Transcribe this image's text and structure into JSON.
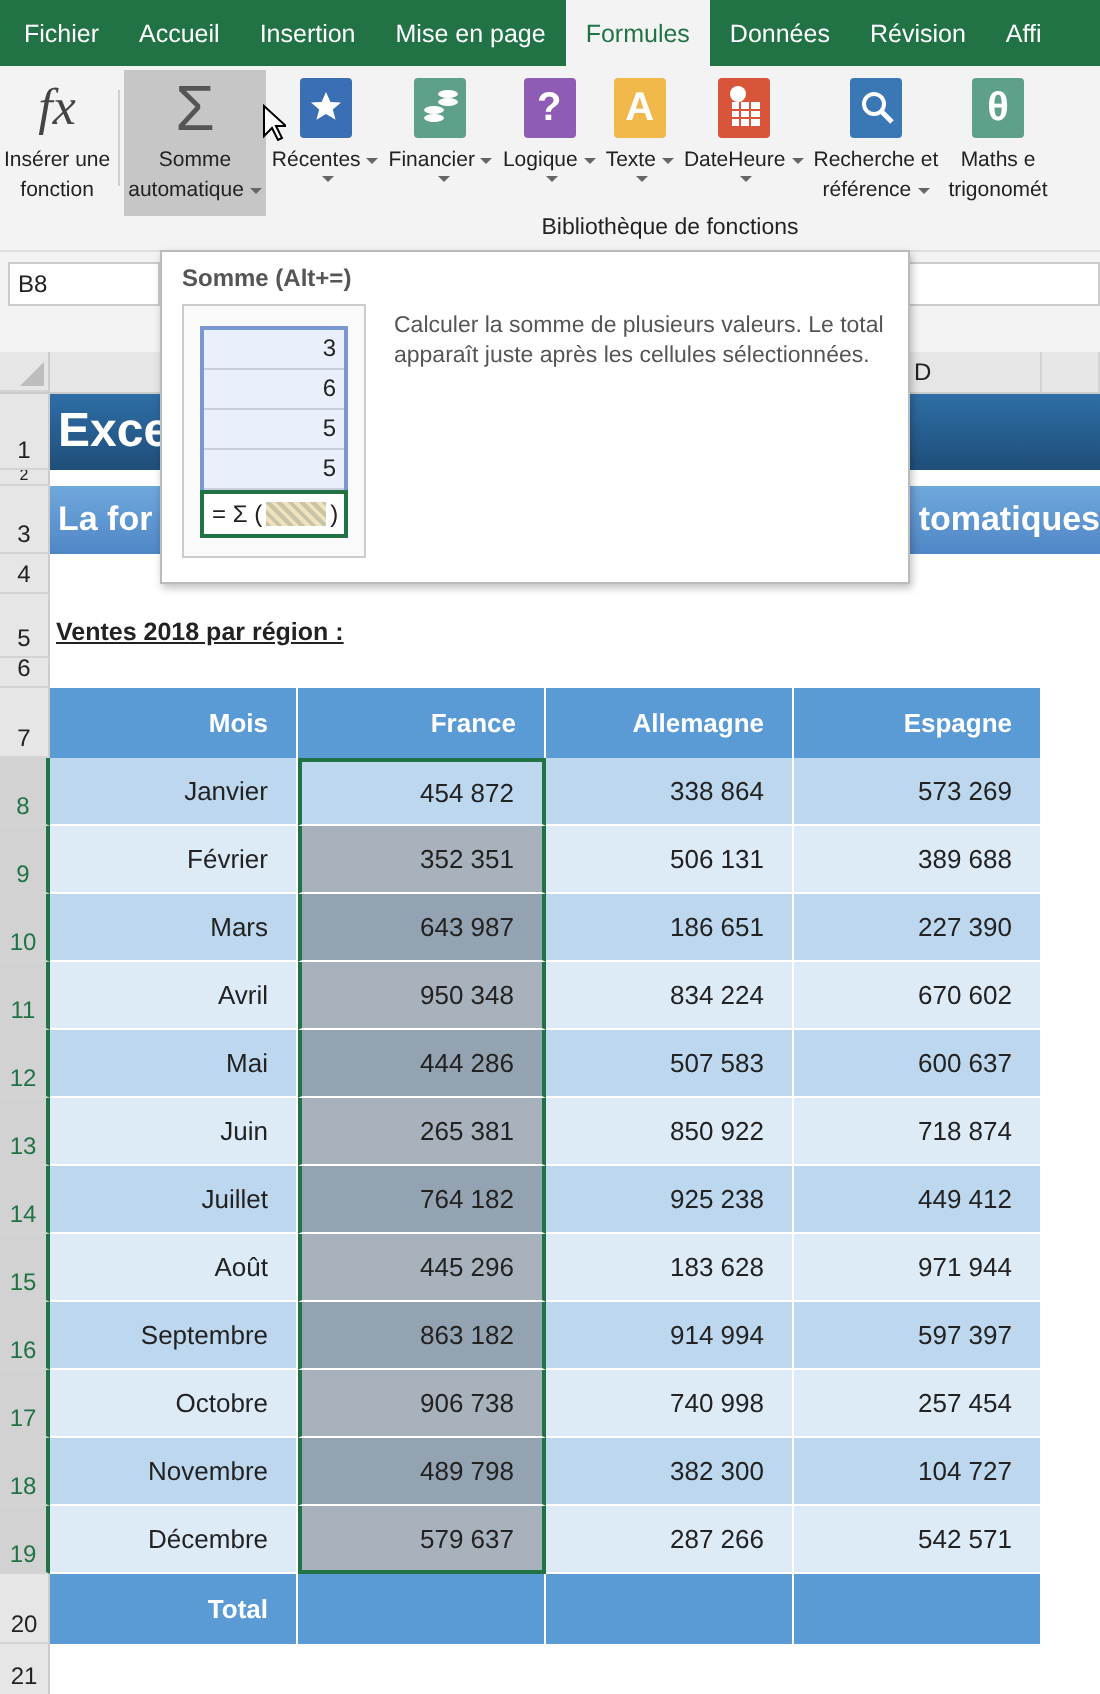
{
  "tabs": [
    {
      "label": "Fichier",
      "selected": false
    },
    {
      "label": "Accueil",
      "selected": false
    },
    {
      "label": "Insertion",
      "selected": false
    },
    {
      "label": "Mise en page",
      "selected": false
    },
    {
      "label": "Formules",
      "selected": true
    },
    {
      "label": "Données",
      "selected": false
    },
    {
      "label": "Révision",
      "selected": false
    },
    {
      "label": "Affi",
      "selected": false
    }
  ],
  "ribbon": {
    "buttons": [
      {
        "kind": "fx",
        "glyph": "fx",
        "lines": [
          "Insérer une",
          "fonction"
        ],
        "dropdown": false,
        "selected": false
      },
      {
        "kind": "sigma",
        "glyph": "Σ",
        "lines": [
          "Somme",
          "automatique"
        ],
        "dropdown": true,
        "selected": true
      },
      {
        "kind": "star",
        "color": "#3a6fb5",
        "lines": [
          "Récentes"
        ],
        "dropdown": true,
        "selected": false
      },
      {
        "kind": "coins",
        "color": "#5fa08a",
        "lines": [
          "Financier"
        ],
        "dropdown": true,
        "selected": false
      },
      {
        "kind": "glyph",
        "glyph": "?",
        "color": "#8e5bb5",
        "lines": [
          "Logique"
        ],
        "dropdown": true,
        "selected": false
      },
      {
        "kind": "glyph",
        "glyph": "A",
        "color": "#f0b94a",
        "lines": [
          "Texte"
        ],
        "dropdown": true,
        "selected": false
      },
      {
        "kind": "calendar",
        "color": "#d9553a",
        "lines": [
          "DateHeure"
        ],
        "dropdown": true,
        "selected": false
      },
      {
        "kind": "search",
        "color": "#3a78b5",
        "lines": [
          "Recherche et",
          "référence"
        ],
        "dropdown": true,
        "selected": false
      },
      {
        "kind": "glyph",
        "glyph": "θ",
        "color": "#5fa08a",
        "lines": [
          "Maths e",
          "trigonomét"
        ],
        "dropdown": false,
        "selected": false
      }
    ],
    "group_label": "Bibliothèque de fonctions"
  },
  "name_box": "B8",
  "tooltip": {
    "title": "Somme (Alt+=)",
    "preview_values": [
      "3",
      "6",
      "5",
      "5"
    ],
    "formula_left": "= Σ (",
    "formula_right": ")",
    "description": "Calculer la somme de plusieurs valeurs. Le total apparaît juste après les cellules sélectionnées."
  },
  "sheet": {
    "column_headers": [
      "D"
    ],
    "title": {
      "row": "1",
      "text": "Exce"
    },
    "row_2": "2",
    "subtitle": {
      "row": "3",
      "text_left": "La for",
      "text_right": "tomatiques"
    },
    "row_4": "4",
    "caption": {
      "row": "5",
      "text": "Ventes 2018 par région :"
    },
    "row_6": "6",
    "table": {
      "row": "7",
      "columns": [
        "Mois",
        "France",
        "Allemagne",
        "Espagne"
      ],
      "rows": [
        {
          "row": "8",
          "selected": true,
          "france_highlight": false,
          "cells": [
            "Janvier",
            "454 872",
            "338 864",
            "573 269"
          ]
        },
        {
          "row": "9",
          "selected": true,
          "france_highlight": true,
          "cells": [
            "Février",
            "352 351",
            "506 131",
            "389 688"
          ]
        },
        {
          "row": "10",
          "selected": true,
          "france_highlight": true,
          "cells": [
            "Mars",
            "643 987",
            "186 651",
            "227 390"
          ]
        },
        {
          "row": "11",
          "selected": true,
          "france_highlight": true,
          "cells": [
            "Avril",
            "950 348",
            "834 224",
            "670 602"
          ]
        },
        {
          "row": "12",
          "selected": true,
          "france_highlight": true,
          "cells": [
            "Mai",
            "444 286",
            "507 583",
            "600 637"
          ]
        },
        {
          "row": "13",
          "selected": true,
          "france_highlight": true,
          "cells": [
            "Juin",
            "265 381",
            "850 922",
            "718 874"
          ]
        },
        {
          "row": "14",
          "selected": true,
          "france_highlight": true,
          "cells": [
            "Juillet",
            "764 182",
            "925 238",
            "449 412"
          ]
        },
        {
          "row": "15",
          "selected": true,
          "france_highlight": true,
          "cells": [
            "Août",
            "445 296",
            "183 628",
            "971 944"
          ]
        },
        {
          "row": "16",
          "selected": true,
          "france_highlight": true,
          "cells": [
            "Septembre",
            "863 182",
            "914 994",
            "597 397"
          ]
        },
        {
          "row": "17",
          "selected": true,
          "france_highlight": true,
          "cells": [
            "Octobre",
            "906 738",
            "740 998",
            "257 454"
          ]
        },
        {
          "row": "18",
          "selected": true,
          "france_highlight": true,
          "cells": [
            "Novembre",
            "489 798",
            "382 300",
            "104 727"
          ]
        },
        {
          "row": "19",
          "selected": true,
          "france_highlight": true,
          "cells": [
            "Décembre",
            "579 637",
            "287 266",
            "542 571"
          ]
        }
      ],
      "total": {
        "row": "20",
        "label": "Total"
      }
    },
    "row_21": "21"
  }
}
